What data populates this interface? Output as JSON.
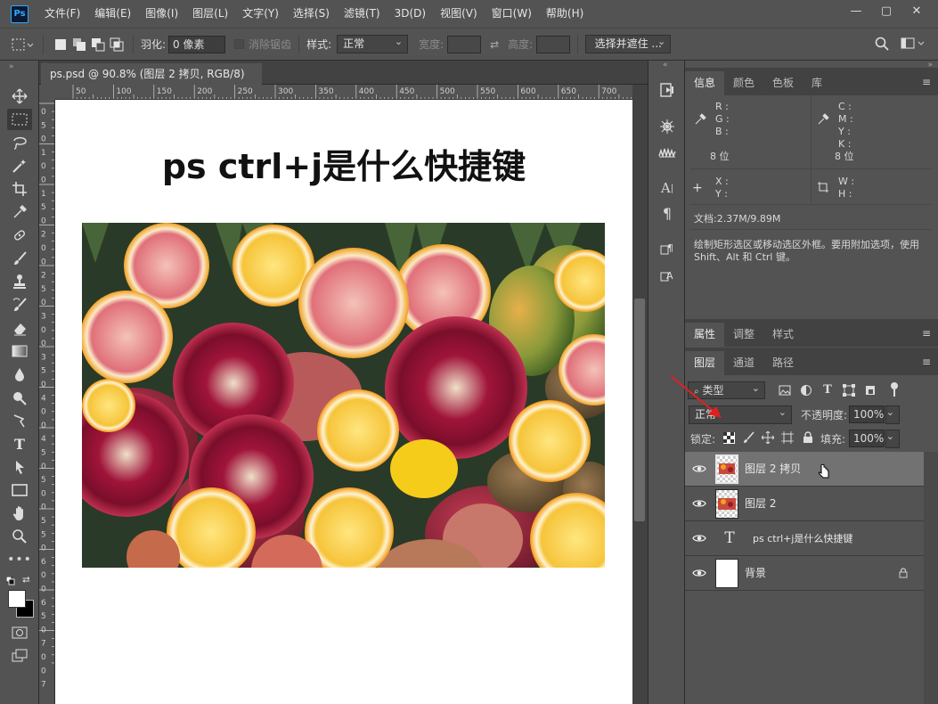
{
  "app": {
    "logo": "Ps"
  },
  "menu": [
    "文件(F)",
    "编辑(E)",
    "图像(I)",
    "图层(L)",
    "文字(Y)",
    "选择(S)",
    "滤镜(T)",
    "3D(D)",
    "视图(V)",
    "窗口(W)",
    "帮助(H)"
  ],
  "window_controls": {
    "minimize": "—",
    "maximize": "▢",
    "close": "✕"
  },
  "options": {
    "feather_label": "羽化:",
    "feather_value": "0 像素",
    "antialias_label": "消除锯齿",
    "style_label": "样式:",
    "style_value": "正常",
    "width_label": "宽度:",
    "height_label": "高度:",
    "select_mask_button": "选择并遮住 ..."
  },
  "document": {
    "tab_title": "ps.psd @ 90.8% (图层 2 拷贝, RGB/8) *",
    "tab_close": "×",
    "ruler_top": [
      "50",
      "100",
      "150",
      "200",
      "250",
      "300",
      "350",
      "400",
      "450",
      "500",
      "550",
      "600",
      "650",
      "700"
    ],
    "ruler_left": [
      "0",
      "5",
      "0",
      "1",
      "0",
      "0",
      "1",
      "5",
      "0",
      "2",
      "0",
      "0",
      "2",
      "5",
      "0",
      "3",
      "0",
      "0",
      "3",
      "5",
      "0",
      "4",
      "0",
      "0",
      "4",
      "5",
      "0",
      "5",
      "0",
      "0",
      "5",
      "5",
      "0",
      "6",
      "0",
      "0",
      "6",
      "5",
      "0",
      "7",
      "0",
      "0",
      "7"
    ],
    "headline": "ps ctrl+j是什么快捷键"
  },
  "panels": {
    "top_tabs": [
      "信息",
      "颜色",
      "色板",
      "库"
    ],
    "info": {
      "rgb": [
        "R :",
        "G :",
        "B :"
      ],
      "cmyk": [
        "C :",
        "M :",
        "Y :",
        "K :"
      ],
      "bits_left": "8 位",
      "bits_right": "8 位",
      "xy": [
        "X :",
        "Y :"
      ],
      "wh": [
        "W :",
        "H :"
      ],
      "doc_size": "文档:2.37M/9.89M",
      "hint": "绘制矩形选区或移动选区外框。要用附加选项，使用 Shift、Alt 和 Ctrl 键。"
    },
    "mid_tabs": [
      "属性",
      "调整",
      "样式"
    ],
    "layer_tabs": [
      "图层",
      "通道",
      "路径"
    ],
    "filter_type": "类型",
    "blend_mode": "正常",
    "opacity_label": "不透明度:",
    "opacity_value": "100%",
    "lock_label": "锁定:",
    "fill_label": "填充:",
    "fill_value": "100%",
    "layers": [
      {
        "name": "图层 2 拷贝",
        "kind": "image",
        "selected": true
      },
      {
        "name": "图层 2",
        "kind": "image",
        "selected": false
      },
      {
        "name": "ps ctrl+j是什么快捷键",
        "kind": "text",
        "selected": false
      },
      {
        "name": "背景",
        "kind": "background",
        "selected": false
      }
    ]
  },
  "colors": {
    "accent": "#31a8ff",
    "annotation_arrow": "#e02020",
    "selected_layer": "#727272"
  }
}
